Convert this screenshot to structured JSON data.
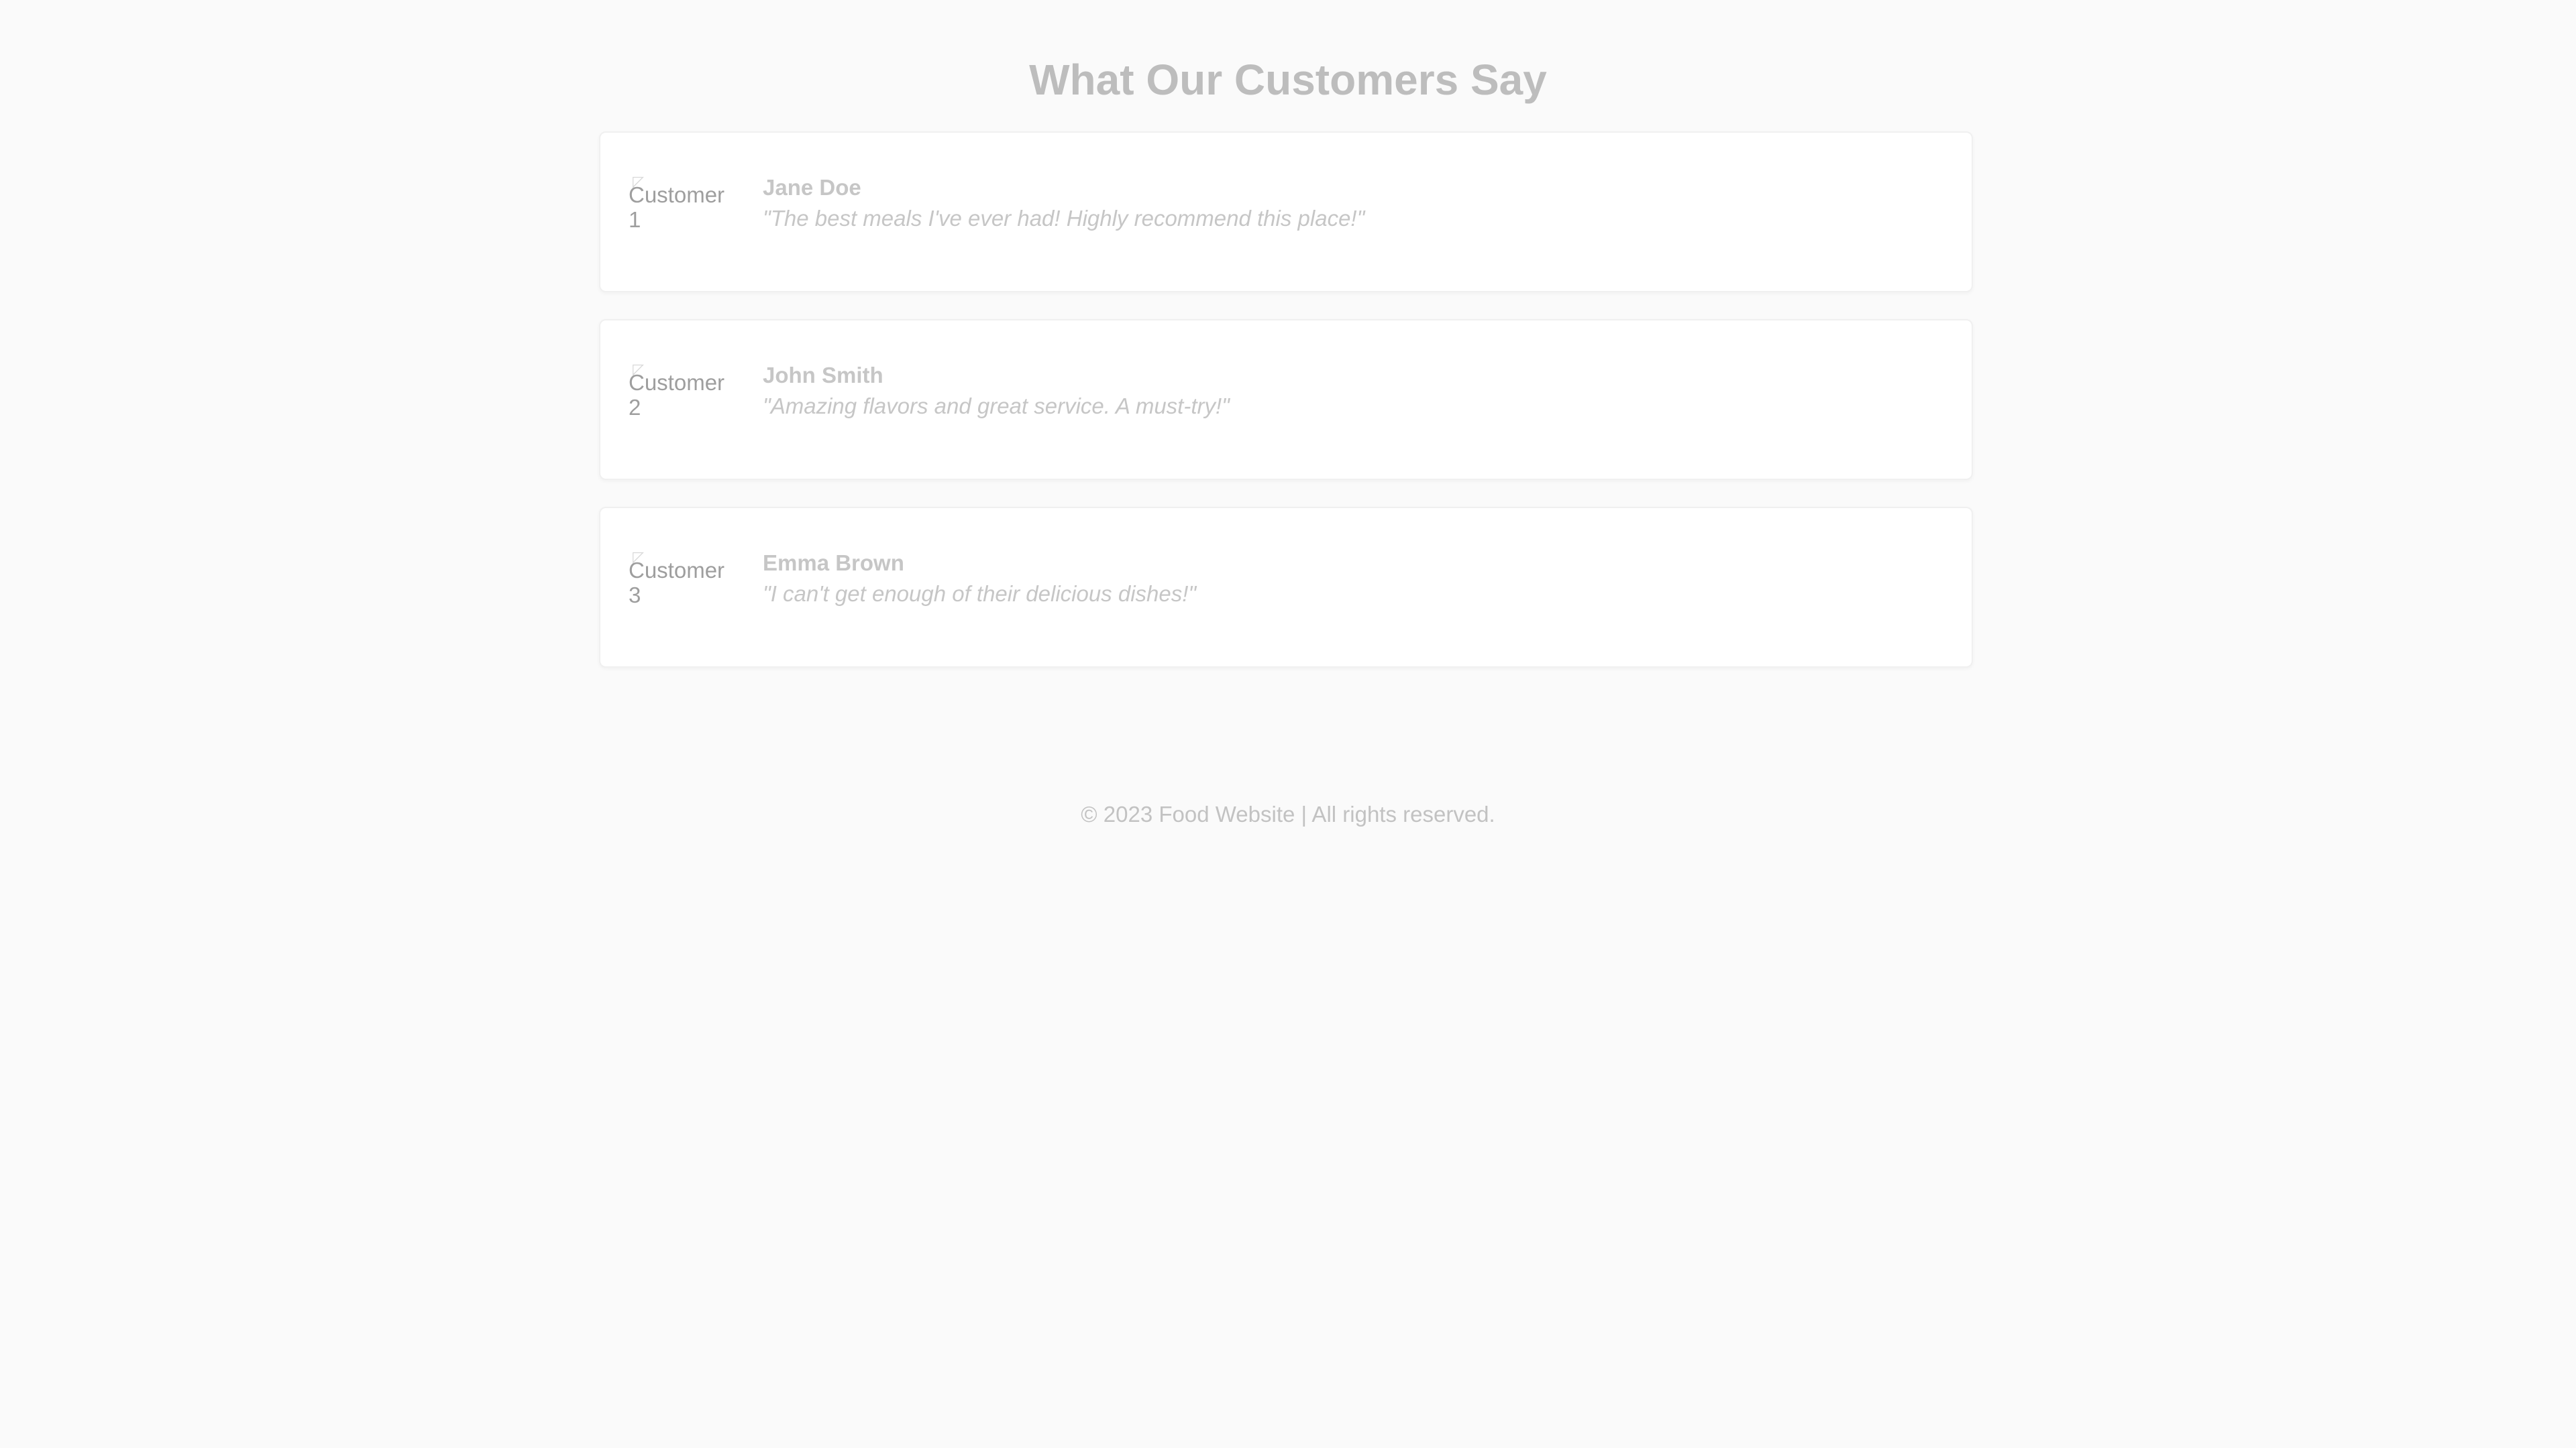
{
  "page": {
    "title": "What Our Customers Say"
  },
  "testimonials": [
    {
      "avatar_alt": "Customer 1",
      "name": "Jane Doe",
      "quote": "\"The best meals I've ever had! Highly recommend this place!\""
    },
    {
      "avatar_alt": "Customer 2",
      "name": "John Smith",
      "quote": "\"Amazing flavors and great service. A must-try!\""
    },
    {
      "avatar_alt": "Customer 3",
      "name": "Emma Brown",
      "quote": "\"I can't get enough of their delicious dishes!\""
    }
  ],
  "footer": {
    "text": "© 2023 Food Website | All rights reserved."
  },
  "colors": {
    "background": "#fafafa",
    "card": "#ffffff",
    "text_muted": "#bdbdbd"
  },
  "icons": {
    "avatar_placeholder": "broken-image-icon"
  }
}
